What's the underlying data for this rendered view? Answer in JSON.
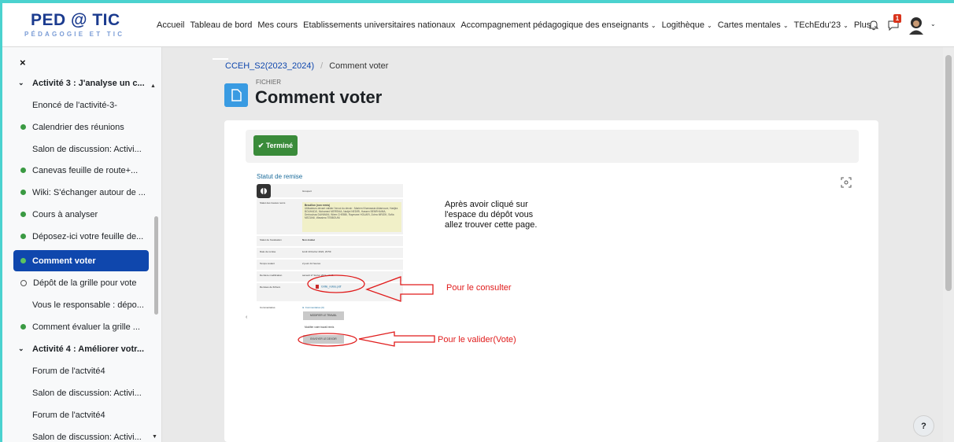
{
  "logo": {
    "title": "PED @ TIC",
    "subtitle": "PÉDAGOGIE ET TIC"
  },
  "nav": {
    "items": [
      {
        "label": "Accueil",
        "dropdown": false
      },
      {
        "label": "Tableau de bord",
        "dropdown": false
      },
      {
        "label": "Mes cours",
        "dropdown": false
      },
      {
        "label": "Etablissements universitaires nationaux",
        "dropdown": false
      },
      {
        "label": "Accompagnement pédagogique des enseignants",
        "dropdown": true
      },
      {
        "label": "Logithèque",
        "dropdown": true
      },
      {
        "label": "Cartes mentales",
        "dropdown": true
      },
      {
        "label": "TEchEdu'23",
        "dropdown": true
      },
      {
        "label": "Plus",
        "dropdown": true
      }
    ],
    "notification_count": "1",
    "caret": "⌄"
  },
  "sidebar": {
    "close": "×",
    "items": [
      {
        "label": "Activité 3 : J'analyse un c...",
        "kind": "section"
      },
      {
        "label": "Enoncé de l'activité-3-",
        "kind": "plain"
      },
      {
        "label": "Calendrier des réunions",
        "kind": "done"
      },
      {
        "label": "Salon de discussion: Activi...",
        "kind": "plain"
      },
      {
        "label": "Canevas feuille de route+...",
        "kind": "done"
      },
      {
        "label": "Wiki: S'échanger autour de ...",
        "kind": "done"
      },
      {
        "label": "Cours à analyser",
        "kind": "done"
      },
      {
        "label": "Déposez-ici votre feuille de...",
        "kind": "done"
      },
      {
        "label": "Comment voter",
        "kind": "active"
      },
      {
        "label": "Dépôt de la grille pour vote",
        "kind": "todo"
      },
      {
        "label": "Vous le responsable : dépo...",
        "kind": "plain"
      },
      {
        "label": "Comment évaluer la grille ...",
        "kind": "done"
      },
      {
        "label": "Activité 4 : Améliorer votr...",
        "kind": "section"
      },
      {
        "label": "Forum de l'actvité4",
        "kind": "plain"
      },
      {
        "label": "Salon de discussion: Activi...",
        "kind": "plain"
      },
      {
        "label": "Forum de l'actvité4",
        "kind": "plain"
      },
      {
        "label": "Salon de discussion: Activi...",
        "kind": "plain"
      }
    ]
  },
  "breadcrumb": {
    "course": "CCEH_S2(2023_2024)",
    "current": "Comment voter"
  },
  "page": {
    "type_label": "FICHIER",
    "title": "Comment voter"
  },
  "completion": {
    "label": "✔ Terminé"
  },
  "embedded": {
    "title": "Statut de remise",
    "header_value": "Groupe4",
    "rows": [
      {
        "label": "Statut des travaux remis",
        "value": "Brouillon (non remis)"
      },
      {
        "label": "Statut de l'évaluation",
        "value": "Non évalué"
      },
      {
        "label": "Date de remise",
        "value": "lundi 19 février 2024, 23:59"
      },
      {
        "label": "Temps restant",
        "value": "2 jours 12 heures"
      },
      {
        "label": "Dernière modification",
        "value": "samedi 17 février 2024, 11:15"
      },
      {
        "label": "Remises de fichiers",
        "value": ""
      },
      {
        "label": "Commentaires",
        "value": "► Commentaires (0)"
      }
    ],
    "highlight_note": "Utilisateurs devant valider l'envoi du devoir : Mariem Khamassia Aldarrouze, Hadjira BOUHADJI, Mohamed MERSNIA, Nadjet NEDIRI, Hassen BENRHAIMA, Derbouhaa DAHMANI, Wiem CHEBBI, Raymane HOUARI, Zohra MRIZIK, Sofia MEZIANI, Wassima TEBBOUNI",
    "file_name": "Grille_notée.pdf",
    "btn_edit": "MODIFIER LE TRAVAIL",
    "edit_hint": "Modifier votre travail remis",
    "btn_submit": "ENVOYER LE DEVOIR"
  },
  "annotations": {
    "intro": "Après avoir cliqué sur l'espace du dépôt vous allez trouver cette page.",
    "consult": "Pour le consulter",
    "validate": "Pour le valider(Vote)"
  },
  "help": "?",
  "colors": {
    "primary": "#0f47ad",
    "success": "#3a8b3a",
    "annotation": "#e01b1b",
    "frame": "#4bd2cf"
  }
}
